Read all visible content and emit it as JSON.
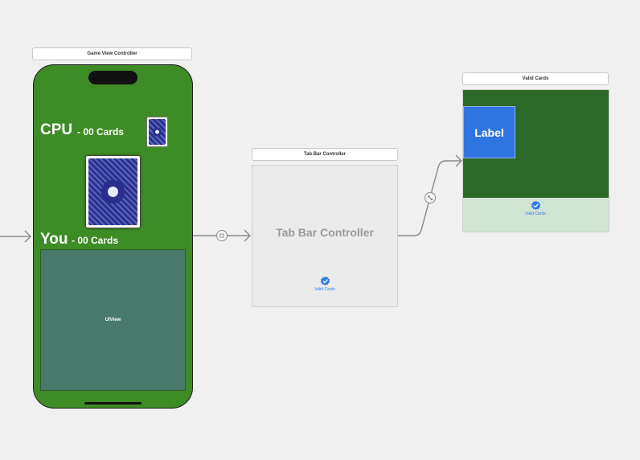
{
  "scenes": {
    "game_view": {
      "title": "Game View Controller",
      "cpu_label": "CPU",
      "cpu_count": "- 00 Cards",
      "you_label": "You",
      "you_count": "- 00 Cards",
      "uiview_label": "UIView"
    },
    "tab_bar": {
      "title": "Tab Bar Controller",
      "placeholder": "Tab Bar Controller",
      "tab_label": "Valid Cards",
      "tab_icon": "checkmark-seal-icon"
    },
    "valid_cards": {
      "title": "Valid Cards",
      "label_text": "Label",
      "tab_label": "Valid Cards",
      "tab_icon": "checkmark-seal-icon"
    }
  },
  "colors": {
    "canvas": "#f0f0f0",
    "game_background": "#3d8c25",
    "uiview_background": "#487a6c",
    "valid_cards_background": "#2b6a27",
    "label_background": "#2f74e0",
    "tab_tint": "#2f7bea"
  }
}
